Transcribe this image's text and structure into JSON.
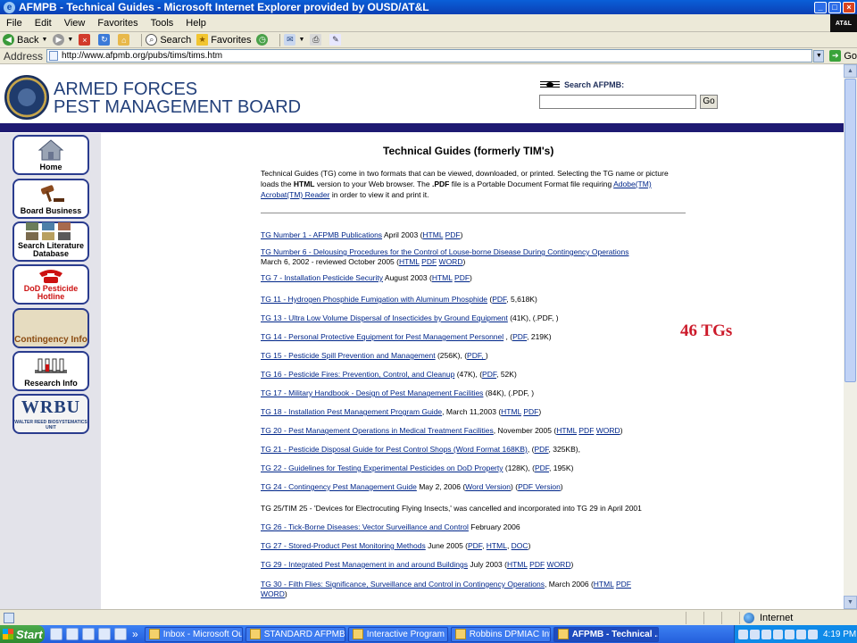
{
  "window": {
    "title": "AFMPB - Technical Guides - Microsoft Internet Explorer provided by OUSD/AT&L",
    "brand_corner": "AT&L"
  },
  "menu": [
    "File",
    "Edit",
    "View",
    "Favorites",
    "Tools",
    "Help"
  ],
  "toolbar": {
    "back": "Back",
    "search": "Search",
    "favorites": "Favorites"
  },
  "address": {
    "label": "Address",
    "url": "http://www.afpmb.org/pubs/tims/tims.htm",
    "go": "Go"
  },
  "site": {
    "brand_line1": "ARMED FORCES",
    "brand_line2": "PEST MANAGEMENT BOARD",
    "search_label": "Search AFPMB:",
    "search_go": "Go"
  },
  "nav": [
    {
      "label": "Home",
      "icon": "house-icon"
    },
    {
      "label": "Board Business",
      "icon": "gavel-icon"
    },
    {
      "label": "Search Literature Database",
      "icon": "literature-thumbnails-icon"
    },
    {
      "label": "DoD Pesticide Hotline",
      "icon": "telephone-icon"
    },
    {
      "label": "Contingency Info",
      "icon": "contingency-icon"
    },
    {
      "label": "Research Info",
      "icon": "test-tubes-icon"
    },
    {
      "label": "WRBU",
      "sublabel": "WALTER REED BIOSYSTEMATICS UNIT",
      "icon": "wrbu-logo"
    }
  ],
  "main": {
    "title": "Technical Guides (formerly TIM's)",
    "intro_1": "Technical Guides (TG) come in two formats that can be viewed, downloaded, or printed. Selecting the TG name or picture loads the ",
    "intro_html": "HTML",
    "intro_2": " version to your Web browser.  The ",
    "intro_pdf": ".PDF",
    "intro_3": " file is a Portable Document Format file requiring ",
    "intro_link": "Adobe(TM) Acrobat(TM) Reader",
    "intro_4": " in order to view it and print it.",
    "tg_count": "46 TGs",
    "tgs": [
      {
        "link": "TG Number 1 - AFPMB Publications",
        "after": " April 2003 (",
        "fmt": [
          "HTML",
          "PDF"
        ],
        "close": ")"
      },
      {
        "link": "TG Number 6 - Delousing Procedures for the Control of Louse-borne Disease During Contingency Operations",
        "line2": "March 6, 2002 - reviewed October 2005    (",
        "fmt": [
          "HTML",
          "PDF",
          "WORD"
        ],
        "close": ")"
      },
      {
        "link": "TG 7 - Installation Pesticide Security",
        "after": " August 2003 (",
        "fmt": [
          "HTML",
          "PDF"
        ],
        "close": ")"
      },
      {
        "link": "TG 11 - Hydrogen Phosphide Fumigation with Aluminum Phosphide",
        "after": "     (",
        "fmt": [
          "PDF"
        ],
        "close": ", 5,618K)"
      },
      {
        "link": "TG 13 - Ultra Low Volume Dispersal of Insecticides by Ground Equipment",
        "after": " (41K),  (.PDF, )"
      },
      {
        "link": "TG 14 - Personal Protective Equipment for Pest Management Personnel",
        "after": " ,  (",
        "fmt": [
          "PDF"
        ],
        "close": ", 219K)"
      },
      {
        "link": "TG 15 - Pesticide Spill Prevention and Management",
        "after": " (256K),  (",
        "fmt": [
          "PDF, "
        ],
        "close": ")"
      },
      {
        "link": "TG 16 - Pesticide Fires: Prevention, Control, and Cleanup",
        "after": " (47K),  (",
        "fmt": [
          "PDF"
        ],
        "close": ", 52K)"
      },
      {
        "link": "TG 17 - Military Handbook - Design of Pest Management Facilities",
        "after": " (84K), (.PDF, )"
      },
      {
        "link": "TG 18 - Installation Pest Management Program Guide",
        "after": ", March 11,2003 (",
        "fmt": [
          "HTML",
          "PDF"
        ],
        "close": ")"
      },
      {
        "link": "TG 20 - Pest Management Operations in Medical Treatment Facilities",
        "after": ", November 2005  (",
        "fmt": [
          "HTML",
          "PDF",
          "WORD"
        ],
        "close": ")"
      },
      {
        "link": "TG 21 - Pesticide Disposal Guide for Pest Control Shops (Word Format 168KB)",
        "after": ", (",
        "fmt": [
          "PDF"
        ],
        "close": ", 325KB),"
      },
      {
        "link": "TG 22 - Guidelines for Testing Experimental Pesticides on DoD Property",
        "after": " (128K), (",
        "fmt": [
          "PDF"
        ],
        "close": ", 195K)"
      },
      {
        "link": "TG 24 - Contingency Pest Management Guide",
        "after": " May 2, 2006 (",
        "fmt": [
          "Word Version"
        ],
        "mid": ")  (",
        "fmt2": [
          "PDF Version"
        ],
        "close": ")"
      },
      {
        "plain": "TG 25/TIM 25 - 'Devices for Electrocuting Flying Insects,' was cancelled and incorporated into TG 29 in April 2001"
      },
      {
        "link": "TG 26 - Tick-Borne Diseases: Vector Surveillance and Control",
        "after": " February 2006"
      },
      {
        "link": "TG 27 - Stored-Product Pest Monitoring Methods",
        "after": " June 2005 (",
        "fmt": [
          "PDF",
          "HTML",
          "DOC"
        ],
        "close": ")"
      },
      {
        "link": "TG 29 - Integrated Pest Management in and around Buildings",
        "after": " July 2003 (",
        "fmt": [
          "HTML",
          "PDF",
          "WORD"
        ],
        "close": ")"
      },
      {
        "link": "TG 30 - Filth Flies: Significance, Surveillance and Control in Contingency Operations",
        "after": ", March 2006 (",
        "fmt": [
          "HTML",
          "PDF"
        ],
        "line2link": "WORD",
        "close": ")"
      }
    ]
  },
  "status": {
    "zone": "Internet"
  },
  "taskbar": {
    "start": "Start",
    "tasks": [
      {
        "label": "Inbox - Microsoft Outl...",
        "active": false
      },
      {
        "label": "STANDARD AFPMB Te...",
        "active": false
      },
      {
        "label": "Interactive Program Br...",
        "active": false
      },
      {
        "label": "Robbins DPMIAC Intro...",
        "active": false
      },
      {
        "label": "AFPMB - Technical ...",
        "active": true
      }
    ],
    "overflow": "»",
    "clock": "4:19 PM"
  }
}
